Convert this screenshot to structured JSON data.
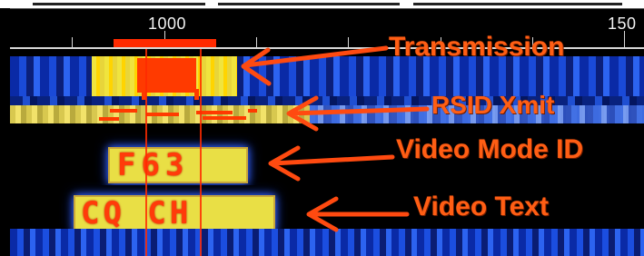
{
  "ruler": {
    "labels": [
      "1000",
      "150"
    ]
  },
  "annotations": {
    "transmission": "Transmission",
    "rsid_xmit": "RSID Xmit",
    "video_mode_id": "Video Mode ID",
    "video_text": "Video Text"
  },
  "signals": {
    "mode_id_text": "F63",
    "video_text": "CQ CH"
  },
  "colors": {
    "annotation": "#ff5e14",
    "transmission_marker": "#ff2a00",
    "waterfall_blue": "#0a2aa6",
    "signal_yellow": "#e9df45"
  }
}
